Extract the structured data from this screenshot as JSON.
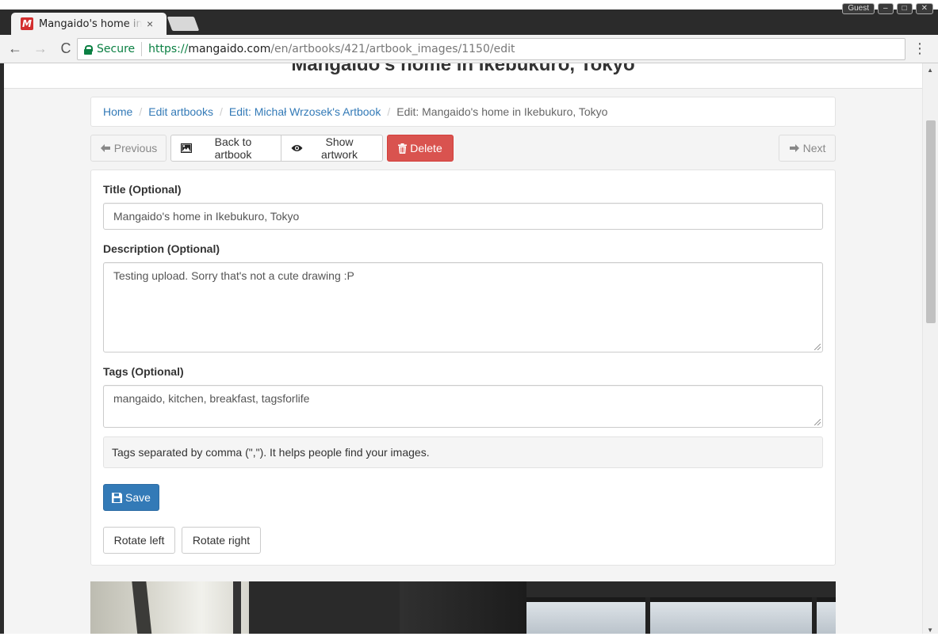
{
  "browser": {
    "tab_title": "Mangaido's home in Ikebukuro, Tokyo",
    "tab_favicon_letter": "M",
    "tab_close": "×",
    "window_user": "Guest",
    "secure_label": "Secure",
    "url_scheme": "https://",
    "url_host": "mangaido.com",
    "url_path": "/en/artbooks/421/artbook_images/1150/edit",
    "back": "←",
    "forward": "→",
    "reload": "C",
    "menu": "⋮"
  },
  "page": {
    "header_title": "Mangaido's home in Ikebukuro, Tokyo"
  },
  "breadcrumb": {
    "home": "Home",
    "edit_artbooks": "Edit artbooks",
    "artbook": "Edit: Michał Wrzosek's Artbook",
    "current": "Edit: Mangaido's home in Ikebukuro, Tokyo",
    "separator": "/"
  },
  "actions": {
    "previous": "Previous",
    "back_to_artbook": "Back to artbook",
    "show_artwork": "Show artwork",
    "delete": "Delete",
    "next": "Next"
  },
  "form": {
    "title_label": "Title (Optional)",
    "title_value": "Mangaido's home in Ikebukuro, Tokyo",
    "description_label": "Description (Optional)",
    "description_value": "Testing upload. Sorry that's not a cute drawing :P",
    "tags_label": "Tags (Optional)",
    "tags_value": "mangaido, kitchen, breakfast, tagsforlife",
    "tags_help": "Tags separated by comma (\",\"). It helps people find your images.",
    "save": "Save",
    "rotate_left": "Rotate left",
    "rotate_right": "Rotate right"
  },
  "colors": {
    "link": "#337ab7",
    "danger": "#d9534f",
    "primary": "#337ab7",
    "secure": "#0b8043"
  }
}
